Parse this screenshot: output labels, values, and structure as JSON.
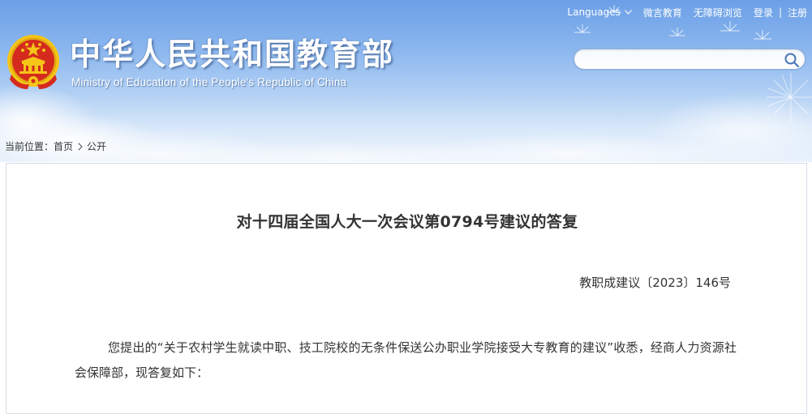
{
  "header": {
    "nav": {
      "languages_label": "Languages",
      "weiyan_label": "微言教育",
      "accessibility_label": "无障碍浏览",
      "login_label": "登录",
      "separator": "|",
      "register_label": "注册"
    },
    "site_title": "中华人民共和国教育部",
    "site_subtitle": "Ministry of Education of the People's Republic of China",
    "search": {
      "value": "",
      "placeholder": ""
    }
  },
  "breadcrumb": {
    "prefix": "当前位置：",
    "home": "首页",
    "current": "公开"
  },
  "article": {
    "title": "对十四届全国人大一次会议第0794号建议的答复",
    "doc_number": "教职成建议〔2023〕146号",
    "paragraph_1": "您提出的“关于农村学生就读中职、技工院校的无条件保送公办职业学院接受大专教育的建议”收悉，经商人力资源社会保障部，现答复如下："
  },
  "colors": {
    "banner_top": "#6b9fe6",
    "banner_bottom": "#e9f2fc",
    "text": "#333333",
    "search_border": "#8eb2e0",
    "emblem_red": "#d52b1e",
    "emblem_gold": "#f5c518"
  },
  "icons": [
    "chevron-down-icon",
    "search-icon",
    "chevron-right-icon",
    "national-emblem-icon"
  ]
}
